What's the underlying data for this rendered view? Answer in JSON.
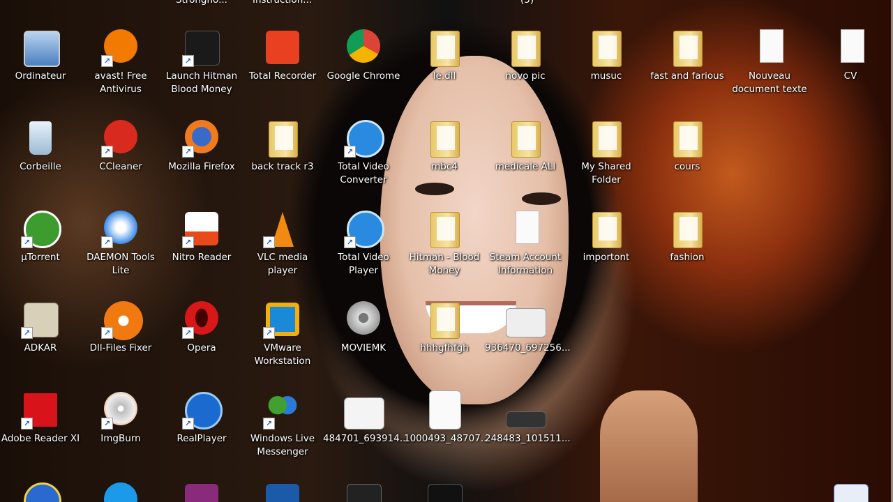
{
  "top_partial": [
    "Strongho...",
    "Instruction...",
    "(5)"
  ],
  "row1": [
    "Ordinateur",
    "avast! Free Antivirus",
    "Launch Hitman Blood Money",
    "Total Recorder",
    "Google Chrome",
    "le.dll",
    "novo pic",
    "musuc",
    "fast and farious",
    "Nouveau document texte",
    "CV"
  ],
  "row2": [
    "Corbeille",
    "CCleaner",
    "Mozilla Firefox",
    "back track r3",
    "Total Video Converter",
    "mbc4",
    "medicale ALI",
    "My Shared Folder",
    "cours"
  ],
  "row3": [
    "µTorrent",
    "DAEMON Tools Lite",
    "Nitro Reader",
    "VLC media player",
    "Total Video Player",
    "Hitman - Blood Money",
    "Steam Account Information",
    "importont",
    "fashion"
  ],
  "row4": [
    "ADKAR",
    "Dll-Files Fixer",
    "Opera",
    "VMware Workstation",
    "MOVIEMK",
    "hhhgfhfgh",
    "936470_697256..."
  ],
  "row5": [
    "Adobe Reader XI",
    "ImgBurn",
    "RealPlayer",
    "Windows Live Messenger",
    "484701_693914...",
    "1000493_48707...",
    "248483_101511..."
  ]
}
